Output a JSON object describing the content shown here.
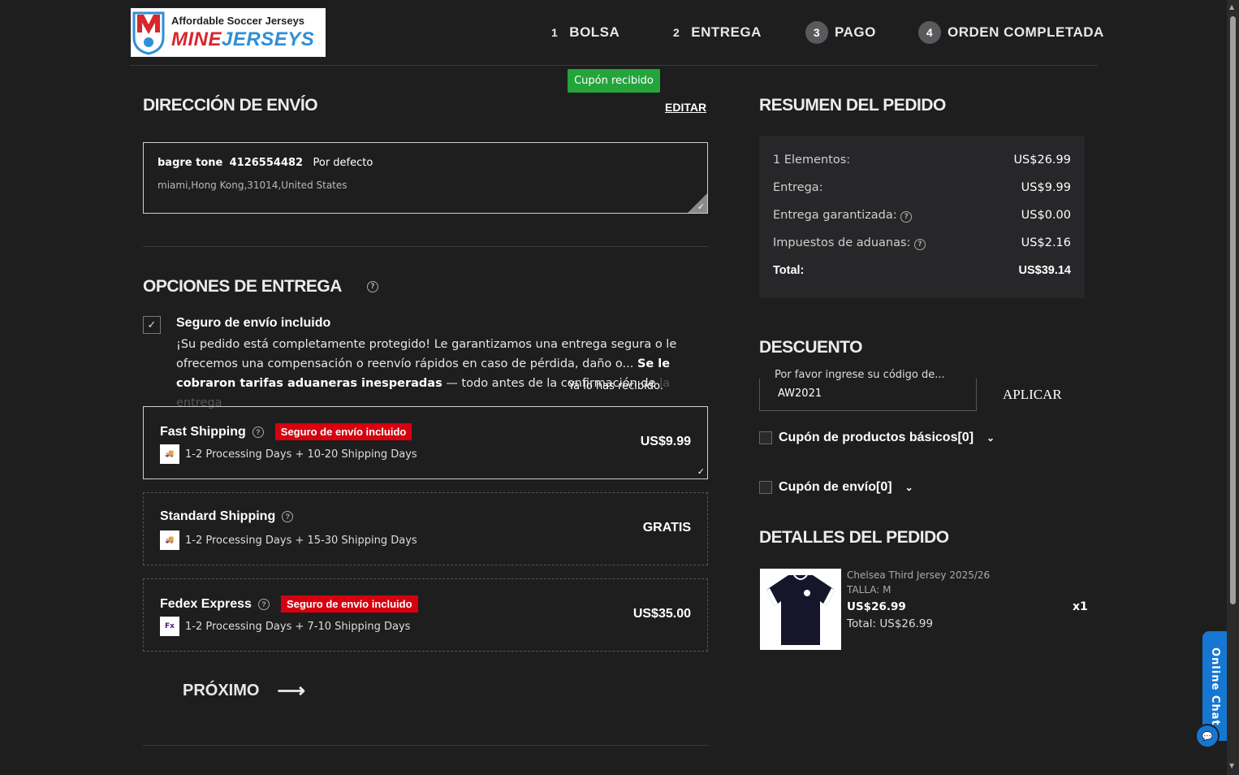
{
  "header": {
    "logo_tagline": "Affordable Soccer Jerseys",
    "logo_brand_1": "MINE",
    "logo_brand_2": "JERSEYS",
    "steps": [
      {
        "num": "1",
        "label": "BOLSA"
      },
      {
        "num": "2",
        "label": "ENTREGA"
      },
      {
        "num": "3",
        "label": "PAGO"
      },
      {
        "num": "4",
        "label": "ORDEN COMPLETADA"
      }
    ]
  },
  "toast": "Cupón recibido",
  "shipping_address": {
    "title": "DIRECCIÓN DE ENVÍO",
    "edit_label": "EDITAR",
    "name": "bagre  tone",
    "phone": "4126554482",
    "default_label": "Por defecto",
    "address_line": "miami,Hong Kong,31014,United States"
  },
  "delivery": {
    "title": "OPCIONES DE ENTREGA",
    "insurance_title": "Seguro de envío incluido",
    "insurance_text_1": "¡Su pedido está completamente protegido! Le garantizamos una entrega segura o le ofrecemos una compensación o reenvío rápidos en caso de pérdida, daño o... ",
    "insurance_text_bold": "Se le cobraron tarifas aduaneras inesperadas",
    "insurance_text_2": " — todo antes de la confirmación de ",
    "insurance_text_fade": "la entrega",
    "overlay_note": "Ya lo has recibido.",
    "options": [
      {
        "name": "Fast Shipping",
        "badge": "Seguro de envío incluido",
        "desc": "1-2 Processing Days + 10-20 Shipping Days",
        "price": "US$9.99",
        "selected": true,
        "icon": "truck-fast-icon"
      },
      {
        "name": "Standard Shipping",
        "badge": "",
        "desc": "1-2 Processing Days + 15-30 Shipping Days",
        "price": "GRATIS",
        "selected": false,
        "icon": "truck-icon"
      },
      {
        "name": "Fedex Express",
        "badge": "Seguro de envío incluido",
        "desc": "1-2 Processing Days + 7-10 Shipping Days",
        "price": "US$35.00",
        "selected": false,
        "icon": "fedex-icon"
      }
    ],
    "next_label": "PRÓXIMO"
  },
  "summary": {
    "title": "RESUMEN DEL PEDIDO",
    "rows": [
      {
        "label": "1 Elementos:",
        "value": "US$26.99"
      },
      {
        "label": "Entrega:",
        "value": "US$9.99"
      },
      {
        "label": "Entrega garantizada:",
        "value": "US$0.00"
      },
      {
        "label": "Impuestos de aduanas:",
        "value": "US$2.16"
      },
      {
        "label": "Total:",
        "value": "US$39.14"
      }
    ]
  },
  "discount": {
    "title": "DESCUENTO",
    "input_label": "Por favor ingrese su código de...",
    "input_value": "AW2021",
    "apply_label": "APLICAR",
    "coupon_products": "Cupón de productos básicos[0]",
    "coupon_shipping": "Cupón de envío[0]"
  },
  "order_details": {
    "title": "DETALLES DEL PEDIDO",
    "product_name": "Chelsea Third Jersey 2025/26",
    "size": "TALLA: M",
    "price": "US$26.99",
    "total": "Total: US$26.99",
    "qty": "x1"
  },
  "chat": {
    "label": "Online Chat"
  },
  "colors": {
    "background": "#1e1e1f",
    "success": "#24a43b",
    "badge_red": "#d6000f",
    "chat_blue": "#1677d2"
  }
}
